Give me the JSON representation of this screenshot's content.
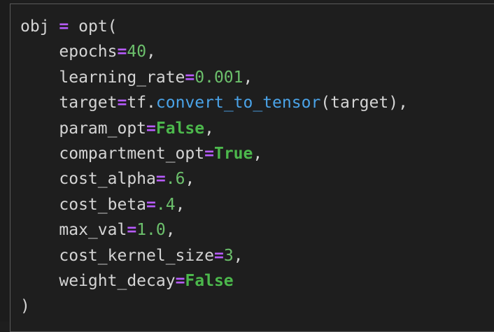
{
  "code": {
    "line1": {
      "var": "obj",
      "eq": "=",
      "call": "opt("
    },
    "args": [
      {
        "name": "epochs",
        "eq": "=",
        "value": "40",
        "trail": ","
      },
      {
        "name": "learning_rate",
        "eq": "=",
        "value": "0.001",
        "trail": ","
      },
      {
        "name": "target",
        "eq": "=",
        "obj": "tf.",
        "fn": "convert_to_tensor",
        "rest": "(target),",
        "trail": ""
      },
      {
        "name": "param_opt",
        "eq": "=",
        "value": "False",
        "trail": ","
      },
      {
        "name": "compartment_opt",
        "eq": "=",
        "value": "True",
        "trail": ","
      },
      {
        "name": "cost_alpha",
        "eq": "=",
        "value": ".6",
        "trail": ","
      },
      {
        "name": "cost_beta",
        "eq": "=",
        "value": ".4",
        "trail": ","
      },
      {
        "name": "max_val",
        "eq": "=",
        "value": "1.0",
        "trail": ","
      },
      {
        "name": "cost_kernel_size",
        "eq": "=",
        "value": "3",
        "trail": ","
      },
      {
        "name": "weight_decay",
        "eq": "=",
        "value": "False",
        "trail": ""
      }
    ],
    "close": ")"
  },
  "colors": {
    "background": "#1e1e1e",
    "text": "#d4d4d4",
    "operator": "#b85cff",
    "number": "#6cc06c",
    "boolean": "#4cb84c",
    "function": "#4aa3e8",
    "border": "#5a5a5a"
  }
}
